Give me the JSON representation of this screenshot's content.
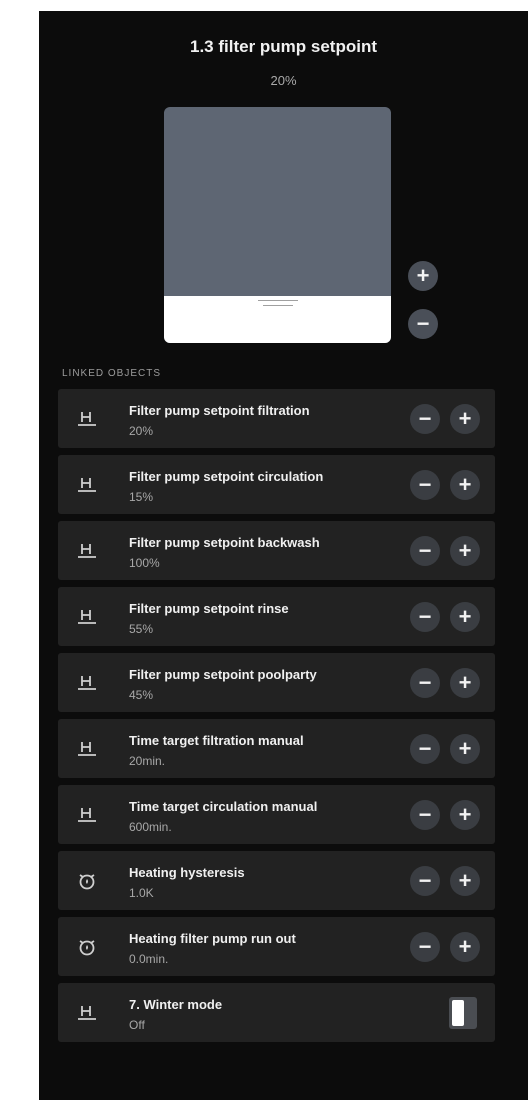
{
  "header": {
    "title": "1.3 filter pump setpoint",
    "value": "20%"
  },
  "slider": {
    "level_percent": 20,
    "increase_label": "+",
    "decrease_label": "−"
  },
  "linked_objects": {
    "section_label": "LINKED OBJECTS",
    "items": [
      {
        "title": "Filter pump setpoint filtration",
        "value": "20%",
        "icon": "pump-icon",
        "control": "stepper"
      },
      {
        "title": "Filter pump setpoint circulation",
        "value": "15%",
        "icon": "pump-icon",
        "control": "stepper"
      },
      {
        "title": "Filter pump setpoint backwash",
        "value": "100%",
        "icon": "pump-icon",
        "control": "stepper"
      },
      {
        "title": "Filter pump setpoint rinse",
        "value": "55%",
        "icon": "pump-icon",
        "control": "stepper"
      },
      {
        "title": "Filter pump setpoint poolparty",
        "value": "45%",
        "icon": "pump-icon",
        "control": "stepper"
      },
      {
        "title": "Time target filtration manual",
        "value": "20min.",
        "icon": "pump-icon",
        "control": "stepper"
      },
      {
        "title": "Time target circulation manual",
        "value": "600min.",
        "icon": "pump-icon",
        "control": "stepper"
      },
      {
        "title": "Heating hysteresis",
        "value": "1.0K",
        "icon": "heating-icon",
        "control": "stepper"
      },
      {
        "title": "Heating filter pump run out",
        "value": "0.0min.",
        "icon": "heating-icon",
        "control": "stepper"
      },
      {
        "title": "7. Winter mode",
        "value": "Off",
        "icon": "pump-icon",
        "control": "toggle"
      }
    ],
    "minus_label": "−",
    "plus_label": "+"
  }
}
